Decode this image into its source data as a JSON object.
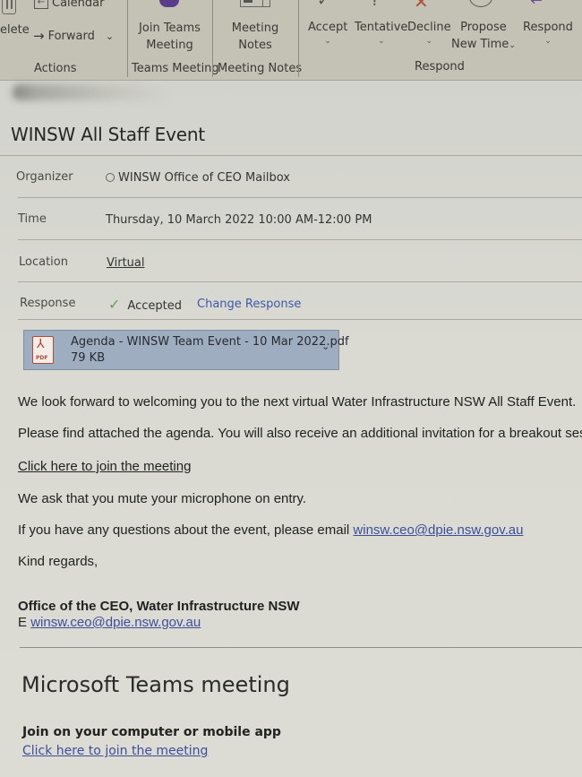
{
  "ribbon": {
    "actions": {
      "calendar_label": "Calendar",
      "delete_label": "elete",
      "forward_label": "Forward",
      "group_label": "Actions"
    },
    "teams_meeting": {
      "join_label_line1": "Join Teams",
      "join_label_line2": "Meeting",
      "group_label": "Teams Meeting"
    },
    "meeting_notes": {
      "label_line1": "Meeting",
      "label_line2": "Notes",
      "group_label": "Meeting Notes"
    },
    "respond": {
      "accept_label": "Accept",
      "tentative_label": "Tentative",
      "decline_label": "Decline",
      "propose_line1": "Propose",
      "propose_line2": "New Time",
      "respond_label": "Respond",
      "group_label": "Respond"
    },
    "chevron": "⌄"
  },
  "message": {
    "subject": "WINSW All Staff Event",
    "fields": {
      "organizer_label": "Organizer",
      "organizer_value": "WINSW Office of CEO Mailbox",
      "time_label": "Time",
      "time_value": "Thursday, 10 March 2022 10:00 AM-12:00 PM",
      "location_label": "Location",
      "location_value": "Virtual",
      "response_label": "Response",
      "response_value": "Accepted",
      "change_response": "Change Response"
    },
    "attachment": {
      "name": "Agenda - WINSW Team Event - 10 Mar 2022.pdf",
      "size": "79 KB",
      "type_label": "PDF"
    },
    "body": {
      "para1": "We look forward to welcoming you to the next virtual Water Infrastructure NSW All Staff Event.",
      "para2": "Please find attached the agenda. You will also receive an additional invitation for a breakout sess",
      "join_link": "Click here to join the meeting",
      "para3": "We ask that you mute your microphone on entry.",
      "para4_prefix": "If you have any questions about the event, please email ",
      "email": "winsw.ceo@dpie.nsw.gov.au",
      "closing": "Kind regards,",
      "signature_name": "Office of the CEO, Water Infrastructure NSW",
      "signature_email_prefix": "E ",
      "signature_email": "winsw.ceo@dpie.nsw.gov.au"
    },
    "teams": {
      "title": "Microsoft Teams meeting",
      "join_heading": "Join on your computer or mobile app",
      "join_link": "Click here to join the meeting"
    }
  },
  "colors": {
    "link": "#3d4f9a",
    "attachment_bg": "#9eaec0",
    "ribbon_bg": "#c4c2b4",
    "accepted_check": "#6a9a5a"
  }
}
